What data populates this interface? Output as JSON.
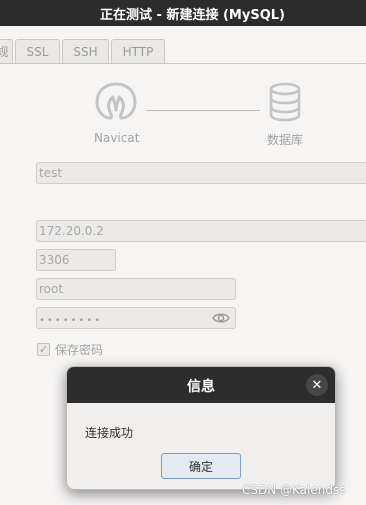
{
  "window": {
    "title": "正在测试 - 新建连接 (MySQL)"
  },
  "tabs": [
    {
      "label": "规"
    },
    {
      "label": "SSL"
    },
    {
      "label": "SSH"
    },
    {
      "label": "HTTP"
    }
  ],
  "diagram": {
    "client_label": "Navicat",
    "server_label": "数据库"
  },
  "fields": {
    "connection_name": "test",
    "host": "172.20.0.2",
    "port": "3306",
    "username": "root",
    "password": "••••••••"
  },
  "save_password": {
    "label": "保存密码",
    "checked": true,
    "check_glyph": "✓"
  },
  "dialog": {
    "title": "信息",
    "message": "连接成功",
    "ok_label": "确定",
    "close_glyph": "✕"
  },
  "watermark": "CSDN @Kalendss"
}
